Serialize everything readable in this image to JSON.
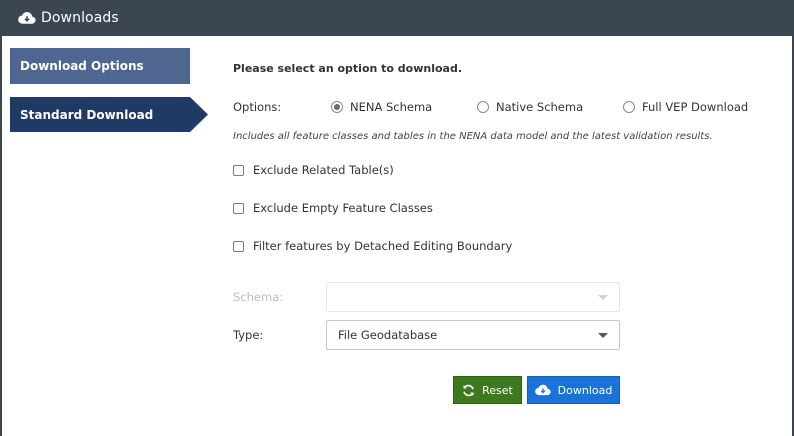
{
  "window": {
    "title": "Downloads",
    "icon": "cloud-download-icon"
  },
  "sidebar": {
    "items": [
      {
        "label": "Download Options",
        "selected": false
      },
      {
        "label": "Standard Download",
        "selected": true
      }
    ]
  },
  "main": {
    "heading": "Please select an option to download.",
    "options_label": "Options:",
    "radios": [
      {
        "label": "NENA Schema",
        "checked": true
      },
      {
        "label": "Native Schema",
        "checked": false
      },
      {
        "label": "Full VEP Download",
        "checked": false
      }
    ],
    "description": "Includes all feature classes and tables in the NENA data model and the latest validation results.",
    "checkboxes": [
      {
        "label": "Exclude Related Table(s)",
        "checked": false
      },
      {
        "label": "Exclude Empty Feature Classes",
        "checked": false
      },
      {
        "label": "Filter features by Detached Editing Boundary",
        "checked": false
      }
    ],
    "schema": {
      "label": "Schema:",
      "value": "",
      "disabled": true
    },
    "type": {
      "label": "Type:",
      "value": "File Geodatabase"
    }
  },
  "buttons": {
    "reset": {
      "label": "Reset",
      "icon": "refresh-icon",
      "color": "#3e7a1d"
    },
    "download": {
      "label": "Download",
      "icon": "cloud-download-icon",
      "color": "#1a73d9"
    }
  },
  "colors": {
    "titlebar": "#3c4650",
    "nav_inactive": "#4f6690",
    "nav_active": "#203a66"
  }
}
